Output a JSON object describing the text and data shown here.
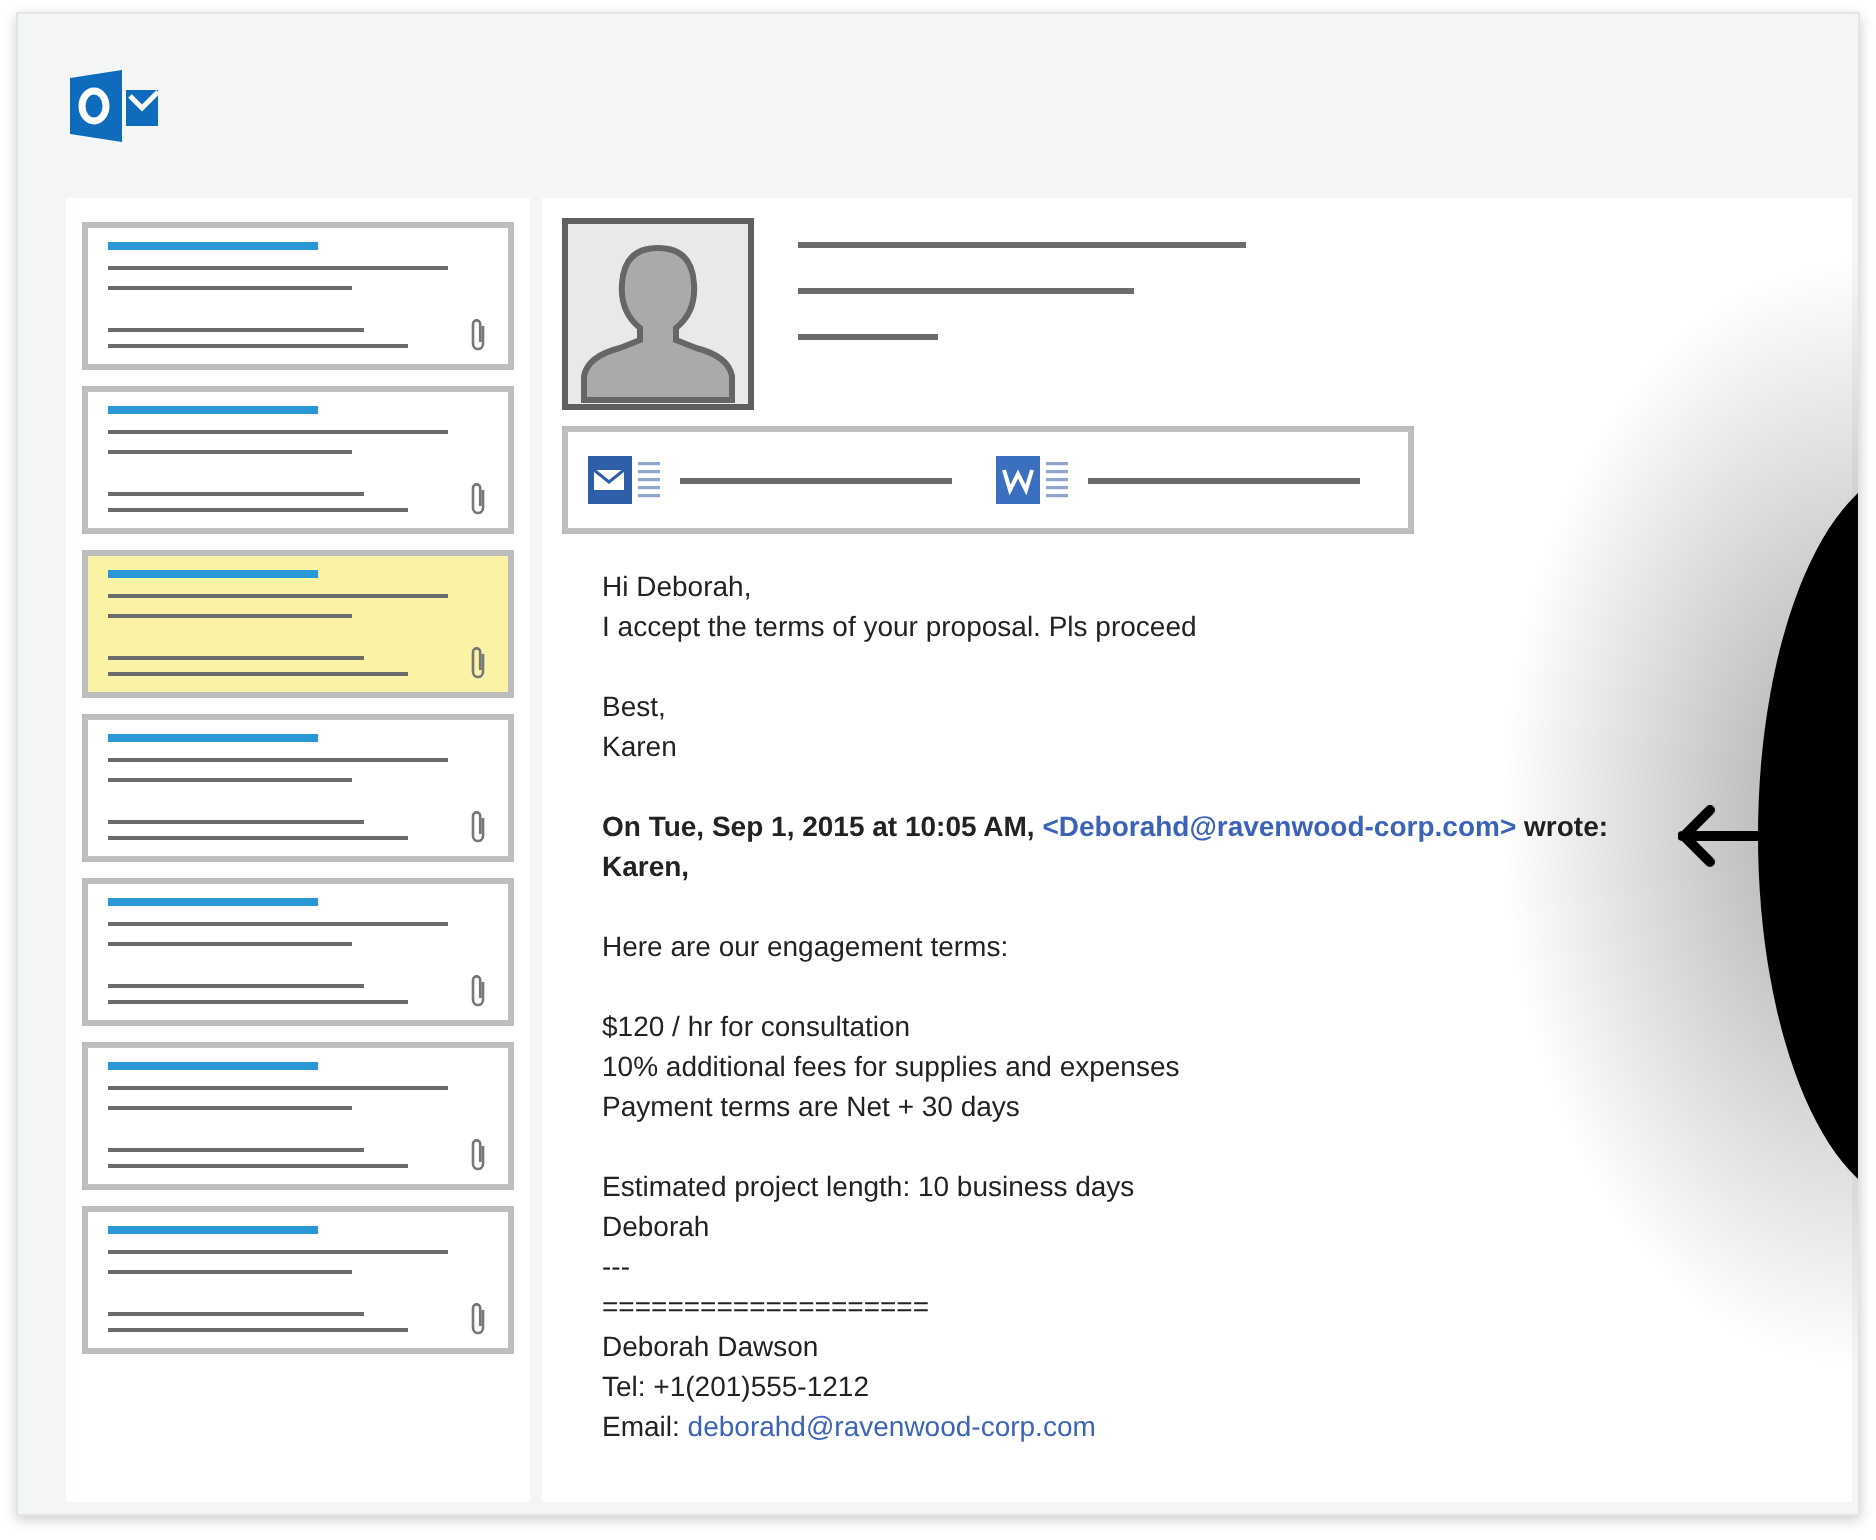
{
  "messages": [
    {
      "selected": false,
      "attachment": true
    },
    {
      "selected": false,
      "attachment": true
    },
    {
      "selected": true,
      "attachment": true
    },
    {
      "selected": false,
      "attachment": true
    },
    {
      "selected": false,
      "attachment": true
    },
    {
      "selected": false,
      "attachment": true
    },
    {
      "selected": false,
      "attachment": true
    }
  ],
  "email": {
    "attachments": [
      {
        "kind": "mail"
      },
      {
        "kind": "word"
      }
    ],
    "paragraphs": [
      [
        {
          "text": "Hi Deborah,",
          "bold": false
        },
        {
          "text": "I accept the terms of your proposal. Pls proceed",
          "bold": false
        }
      ],
      [
        {
          "text": "Best,",
          "bold": false
        },
        {
          "text": "Karen",
          "bold": false
        }
      ],
      [
        {
          "text": "On Tue, Sep 1, 2015 at 10:05 AM,",
          "link": "<Deborahd@ravenwood-corp.com>",
          "after": "wrote:",
          "bold": true
        },
        {
          "text": "Karen,",
          "bold": true
        }
      ],
      [
        {
          "text": "Here are our engagement terms:",
          "bold": false
        }
      ],
      [
        {
          "text": "$120 / hr for consultation",
          "bold": false
        },
        {
          "text": "10% additional fees for supplies and expenses",
          "bold": false
        },
        {
          "text": "Payment terms are Net + 30 days",
          "bold": false
        }
      ],
      [
        {
          "text": "Estimated project length: 10 business days",
          "bold": false
        },
        {
          "text": "Deborah",
          "bold": false
        },
        {
          "text": "---",
          "bold": false
        },
        {
          "text": "====================",
          "bold": false
        },
        {
          "text": "Deborah Dawson",
          "bold": false
        },
        {
          "text": "Tel: +1(201)555-1212",
          "bold": false
        },
        {
          "text": "Email:",
          "link": "deborahd@ravenwood-corp.com",
          "bold": false
        }
      ]
    ]
  }
}
